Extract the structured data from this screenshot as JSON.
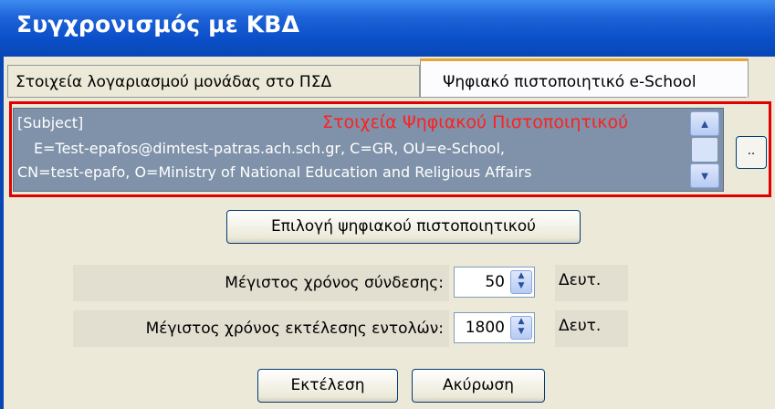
{
  "window": {
    "title": "Συγχρονισμός με ΚΒΔ"
  },
  "tabs": [
    {
      "label": "Στοιχεία λογαριασμού μονάδας στο ΠΣΔ",
      "active": false
    },
    {
      "label": "Ψηφιακό πιστοποιητικό e-School",
      "active": true
    }
  ],
  "certificate": {
    "overlay_label": "Στοιχεία Ψηφιακού Πιστοποιητικού",
    "lines": [
      "[Subject]",
      "E=Test-epafos@dimtest-patras.ach.sch.gr, C=GR, OU=e-School,",
      "CN=test-epafo, O=Ministry of National Education and Religious Affairs"
    ],
    "browse_label": ".."
  },
  "buttons": {
    "select_cert": "Επιλογή ψηφιακού πιστοποιητικού",
    "execute": "Εκτέλεση",
    "cancel": "Ακύρωση"
  },
  "settings": {
    "connect_label": "Μέγιστος χρόνος σύνδεσης:",
    "connect_value": "50",
    "exec_label": "Μέγιστος χρόνος εκτέλεσης εντολών:",
    "exec_value": "1800",
    "unit": "Δευτ."
  },
  "colors": {
    "title_bar": "#0a4fc8",
    "highlight_box": "#e00000",
    "selection": "#7f92a9",
    "overlay_text": "#ff2020"
  }
}
